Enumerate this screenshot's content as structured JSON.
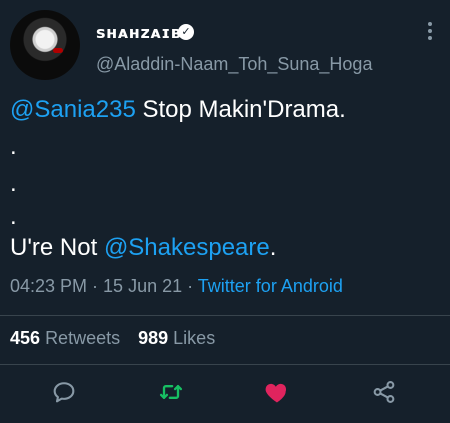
{
  "colors": {
    "background": "#15202b",
    "text": "#ffffff",
    "secondary": "#8899a6",
    "accent": "#1da1f2",
    "retweet_active": "#17bf63",
    "like_active": "#e0245e",
    "divider": "#38444d"
  },
  "author": {
    "display_name": "ꜱʜᴀʜᴢᴀɪʙ",
    "verified_icon": "✓",
    "handle": "@Aladdin-Naam_Toh_Suna_Hoga"
  },
  "tweet": {
    "mention_1": "@Sania235",
    "text_1": " Stop Makin'Drama.",
    "dots": [
      ".",
      ".",
      "."
    ],
    "text_2": "U're Not ",
    "mention_2": "@Shakespeare",
    "text_2_end": "."
  },
  "meta": {
    "time": "04:23 PM",
    "sep1": " · ",
    "date": "15 Jun 21",
    "sep2": " · ",
    "source": "Twitter for Android"
  },
  "stats": {
    "retweets_count": "456",
    "retweets_label": "Retweets",
    "likes_count": "989",
    "likes_label": "Likes"
  },
  "icons": {
    "more": "more-vertical-icon",
    "reply": "reply-icon",
    "retweet": "retweet-icon",
    "like": "heart-icon",
    "share": "share-icon"
  },
  "state": {
    "retweeted": true,
    "liked": true
  }
}
